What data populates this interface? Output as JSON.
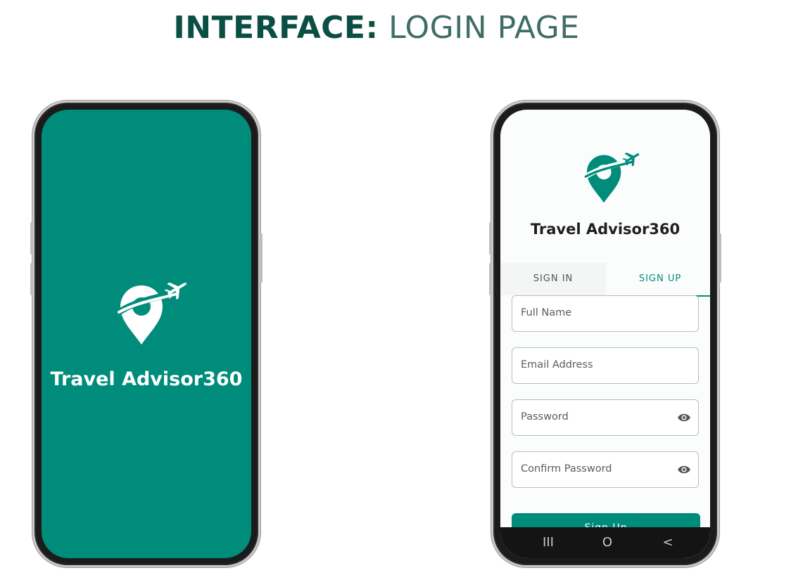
{
  "heading": {
    "bold": "INTERFACE:",
    "light": "LOGIN PAGE"
  },
  "splash": {
    "app_name": "Travel Advisor360"
  },
  "signup_screen": {
    "app_name": "Travel Advisor360",
    "tabs": [
      {
        "label": "SIGN IN"
      },
      {
        "label": "SIGN UP"
      }
    ],
    "active_tab": "SIGN UP",
    "fields": [
      {
        "placeholder": "Full Name"
      },
      {
        "placeholder": "Email Address"
      },
      {
        "placeholder": "Password",
        "icon": "eye-icon"
      },
      {
        "placeholder": "Confirm Password",
        "icon": "eye-icon"
      }
    ],
    "submit_label": "Sign Up",
    "nav": {
      "recents": "III",
      "home": "O",
      "back": "<"
    }
  },
  "colors": {
    "brand": "#008c7b",
    "heading_dark": "#0b4f44",
    "heading_light": "#3f6e66"
  }
}
